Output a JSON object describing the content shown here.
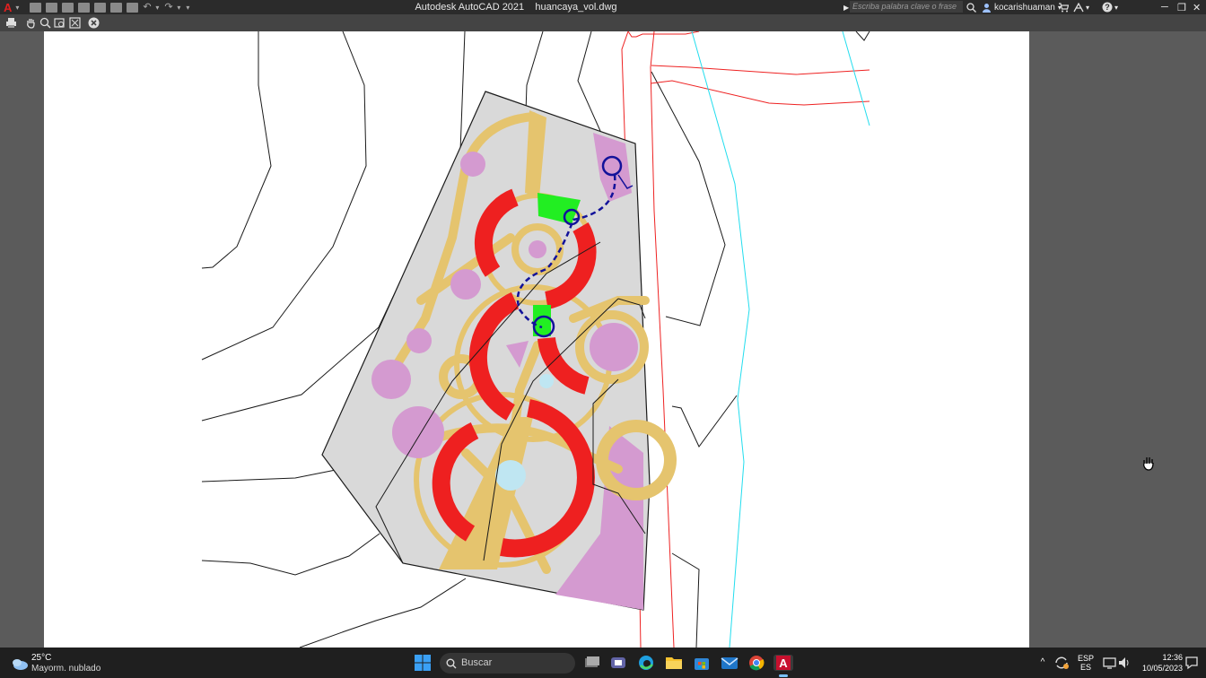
{
  "window": {
    "title": "Autodesk AutoCAD 2021    huancaya_vol.dwg",
    "app_logo": "A",
    "search_placeholder": "Escriba palabra clave o frase",
    "user": "kocarishuaman",
    "min_icon": "─",
    "max_icon": "❐",
    "close_icon": "✕"
  },
  "toolbar2": {
    "items": [
      "print-icon",
      "pan-icon",
      "zoom-icon",
      "zoom-window-icon",
      "zoom-extents-icon",
      "close-preview-icon"
    ]
  },
  "colors": {
    "titlebar": "#2b2b2b",
    "canvas": "#5b5b5b",
    "sheet": "#ffffff",
    "parcel_fill": "#d9d9d9",
    "path_tan": "#e5c46e",
    "plaza_pink": "#d49ad0",
    "arc_red": "#ee2020",
    "lawn_green": "#22ee22",
    "route_blue": "#12129a",
    "river_cyan": "#22ddee",
    "road_red": "#ee2222"
  },
  "taskbar": {
    "weather_temp": "25°C",
    "weather_desc": "Mayorm. nublado",
    "search_label": "Buscar",
    "lang_top": "ESP",
    "lang_bottom": "ES",
    "time": "12:36",
    "date": "10/05/2023"
  }
}
